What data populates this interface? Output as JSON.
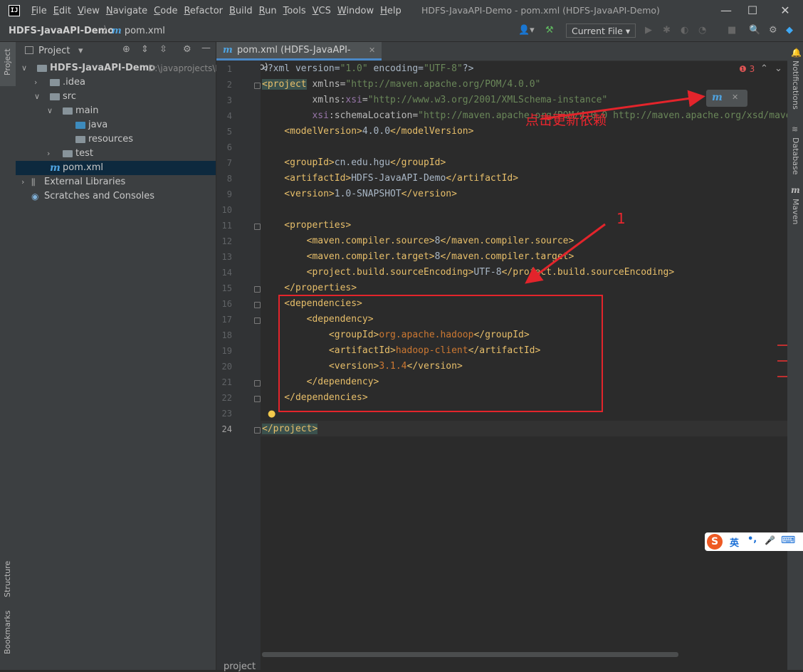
{
  "titlebar": {
    "menu": [
      "File",
      "Edit",
      "View",
      "Navigate",
      "Code",
      "Refactor",
      "Build",
      "Run",
      "Tools",
      "VCS",
      "Window",
      "Help"
    ],
    "window_title": "HDFS-JavaAPI-Demo - pom.xml (HDFS-JavaAPI-Demo)",
    "minimize": "—",
    "maximize": "☐",
    "close": "✕"
  },
  "navbar": {
    "project": "HDFS-JavaAPI-Demo",
    "separator": "⟩",
    "file_icon": "m",
    "file": "pom.xml",
    "run_config": "Current File",
    "run_config_arrow": "▾"
  },
  "left_strip": {
    "project": "Project",
    "structure": "Structure",
    "bookmarks": "Bookmarks"
  },
  "right_strip": {
    "notifications": "Notifications",
    "database": "Database",
    "maven": "Maven"
  },
  "project_panel": {
    "title": "Project",
    "dropdown": "▾",
    "tree": [
      {
        "label": "HDFS-JavaAPI-Demo",
        "path": "D:\\javaprojects\\HD",
        "indent": 0,
        "arrow": "∨",
        "bold": true
      },
      {
        "label": ".idea",
        "indent": 1,
        "arrow": "›"
      },
      {
        "label": "src",
        "indent": 1,
        "arrow": "∨"
      },
      {
        "label": "main",
        "indent": 2,
        "arrow": "∨"
      },
      {
        "label": "java",
        "indent": 3,
        "arrow": "",
        "blue": true
      },
      {
        "label": "resources",
        "indent": 3,
        "arrow": ""
      },
      {
        "label": "test",
        "indent": 2,
        "arrow": "›"
      },
      {
        "label": "pom.xml",
        "indent": 1,
        "arrow": "",
        "file": true,
        "selected": true
      },
      {
        "label": "External Libraries",
        "indent": 0,
        "arrow": "›",
        "lib": true
      },
      {
        "label": "Scratches and Consoles",
        "indent": 0,
        "arrow": "",
        "scratch": true
      }
    ]
  },
  "editor": {
    "tab_icon": "m",
    "tab_label": "pom.xml (HDFS-JavaAPI-Demo)",
    "tab_close": "✕",
    "problems_count": "3",
    "line_numbers": [
      "1",
      "2",
      "3",
      "4",
      "5",
      "6",
      "7",
      "8",
      "9",
      "10",
      "11",
      "12",
      "13",
      "14",
      "15",
      "16",
      "17",
      "18",
      "19",
      "20",
      "21",
      "22",
      "23",
      "24"
    ],
    "bottom_label": "project"
  },
  "annotations": {
    "update_deps": "点击更新依赖",
    "step_number": "1"
  },
  "popup": {
    "icon": "m",
    "close": "✕"
  },
  "ime": {
    "logo": "S",
    "lang": "英",
    "punct": "•,",
    "mic": "🎤",
    "keyboard": "⌨"
  }
}
